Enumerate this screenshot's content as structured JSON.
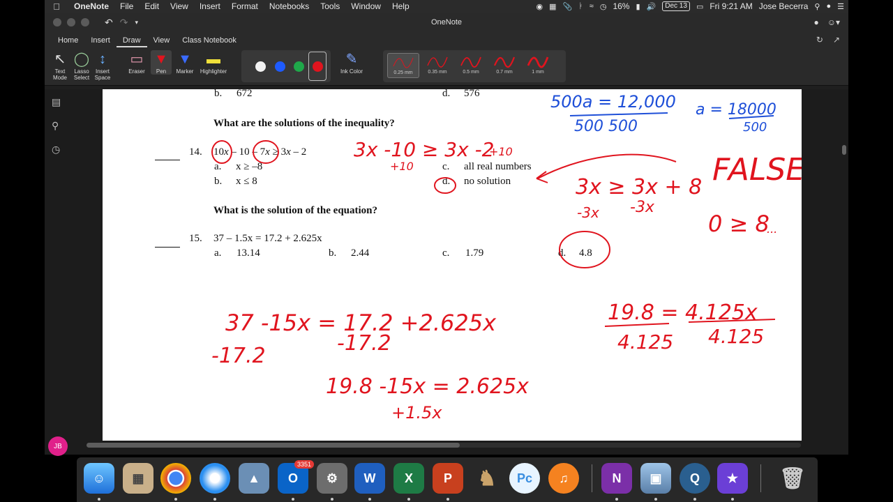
{
  "menubar": {
    "app_name": "OneNote",
    "menus": [
      "File",
      "Edit",
      "View",
      "Insert",
      "Format",
      "Notebooks",
      "Tools",
      "Window",
      "Help"
    ],
    "battery": "16%",
    "date": "Dec 13",
    "clock": "Fri 9:21 AM",
    "user": "Jose Becerra"
  },
  "window": {
    "title": "OneNote",
    "tabs": [
      "Home",
      "Insert",
      "Draw",
      "View",
      "Class Notebook"
    ],
    "active_tab": "Draw"
  },
  "ribbon": {
    "text_mode": "Text Mode",
    "lasso_select": "Lasso Select",
    "insert_space": "Insert Space",
    "eraser": "Eraser",
    "pen": "Pen",
    "marker": "Marker",
    "highlighter": "Highlighter",
    "ink_color": "Ink Color",
    "colors": [
      "#f2f2f2",
      "#1e5bff",
      "#1fa84a",
      "#e0141e"
    ],
    "selected_color": "#e0141e",
    "thickness": [
      "0.25 mm",
      "0.35 mm",
      "0.5 mm",
      "0.7 mm",
      "1 mm"
    ],
    "selected_thickness": "0.25 mm"
  },
  "sidebar": {
    "avatar_initials": "JB"
  },
  "worksheet": {
    "q13_b": "b.",
    "q13_b_val": "672",
    "q13_d": "d.",
    "q13_d_val": "576",
    "heading_inequality": "What are the solutions of the inequality?",
    "q14_num": "14.",
    "q14_eq_a": "10",
    "q14_eq_b": "x",
    "q14_eq_c": " – 10 – 7",
    "q14_eq_d": "x",
    "q14_eq_e": " ≥ 3",
    "q14_eq_f": "x",
    "q14_eq_g": " – 2",
    "q14_a": "a.",
    "q14_a_val": "x ≥ –8",
    "q14_b": "b.",
    "q14_b_val": "x ≤ 8",
    "q14_c": "c.",
    "q14_c_val": "all real numbers",
    "q14_d": "d.",
    "q14_d_val": "no solution",
    "heading_equation": "What is the solution of the equation?",
    "q15_num": "15.",
    "q15_eq": "37 – 1.5x = 17.2 + 2.625x",
    "q15_a": "a.",
    "q15_a_val": "13.14",
    "q15_b": "b.",
    "q15_b_val": "2.44",
    "q15_c": "c.",
    "q15_c_val": "1.79",
    "q15_d": "d.",
    "q15_d_val": "4.8"
  },
  "ink": {
    "blue_1": "500a = 12,000",
    "blue_2": "500      500",
    "blue_3": "a = 18000",
    "blue_4": "500",
    "red_1": "3x -10 ≥ 3x -2",
    "red_2": "+10",
    "red_3": "+10",
    "red_4": "3x ≥ 3x + 8",
    "red_false": "FALSE!",
    "red_5": "-3x",
    "red_6": "-3x",
    "red_7": "0 ≥ 8",
    "red_7b": "...",
    "red_8": "37 -15x = 17.2 +2.625x",
    "red_9": "-17.2",
    "red_10": "-17.2",
    "red_11": "19.8 -15x = 2.625x",
    "red_12": "+1.5x",
    "red_13": "19.8 = 4.125x",
    "red_14": "4.125",
    "red_15": "4.125"
  },
  "dock": {
    "outlook_badge": "3351",
    "apps": [
      "finder",
      "calculator",
      "chrome",
      "safari",
      "preview",
      "outlook",
      "system-preferences",
      "word",
      "excel",
      "powerpoint",
      "chess",
      "pc",
      "google-play-music",
      "onenote",
      "image-capture",
      "quicktime",
      "imovie",
      "trash"
    ]
  },
  "colors": {
    "ink_red": "#e0141e",
    "ink_blue": "#1e4fd8",
    "avatar": "#e0208a"
  }
}
